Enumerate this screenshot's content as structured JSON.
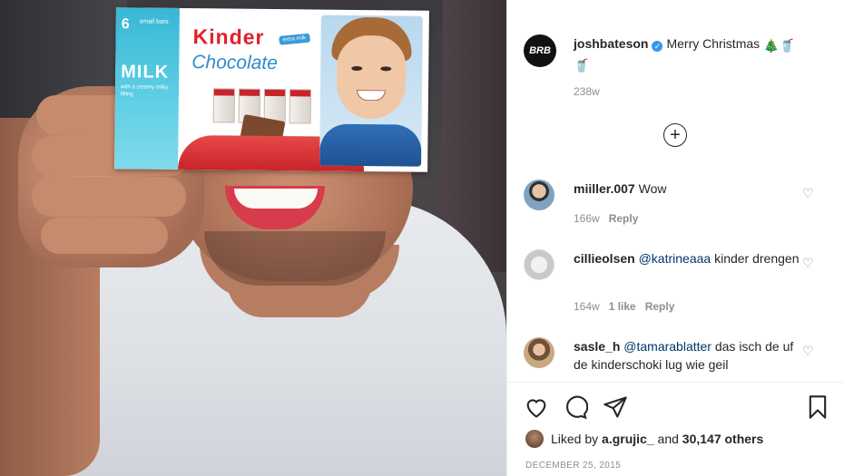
{
  "post": {
    "author": {
      "avatar_text": "BRB",
      "username": "joshbateson",
      "verified": true
    },
    "caption_text": "Merry Christmas",
    "caption_emojis": [
      "🎄",
      "🥤",
      "🥤"
    ],
    "caption_time": "238w",
    "add_button_icon": "plus-circle-icon"
  },
  "photo": {
    "box": {
      "count": "6",
      "count_label": "small bars",
      "milk": "MILK",
      "milk_sub": "with a creamy milky filling",
      "brand": "Kinder",
      "brand_tag": "extra milk",
      "product": "Chocolate"
    }
  },
  "comments": [
    {
      "username": "miiller.007",
      "text": "Wow",
      "time": "166w",
      "likes": "",
      "reply": "Reply",
      "avatar_colors": [
        "#5a7f9a",
        "#2f2f2f"
      ]
    },
    {
      "username": "cillieolsen",
      "mention": "@katrineaaa",
      "text": "kinder drengen",
      "time": "164w",
      "likes": "1 like",
      "reply": "Reply",
      "avatar_colors": [
        "#d9d9d9",
        "#a0a0a0"
      ]
    },
    {
      "username": "sasle_h",
      "mention": "@tamarablatter",
      "text": "das isch de uf de kinderschoki lug wie geil",
      "time": "",
      "likes": "",
      "reply": "",
      "avatar_colors": [
        "#c9a880",
        "#6e4f3a"
      ]
    }
  ],
  "actions": {
    "like_icon": "heart-icon",
    "comment_icon": "comment-icon",
    "share_icon": "paper-plane-icon",
    "save_icon": "bookmark-icon"
  },
  "likes": {
    "prefix": "Liked by",
    "user": "a.grujic_",
    "and": "and",
    "others": "30,147 others"
  },
  "date": "DECEMBER 25, 2015",
  "colors": {
    "link": "#00376b",
    "muted": "#8e8e8e",
    "text": "#262626",
    "verified": "#3897f0"
  }
}
